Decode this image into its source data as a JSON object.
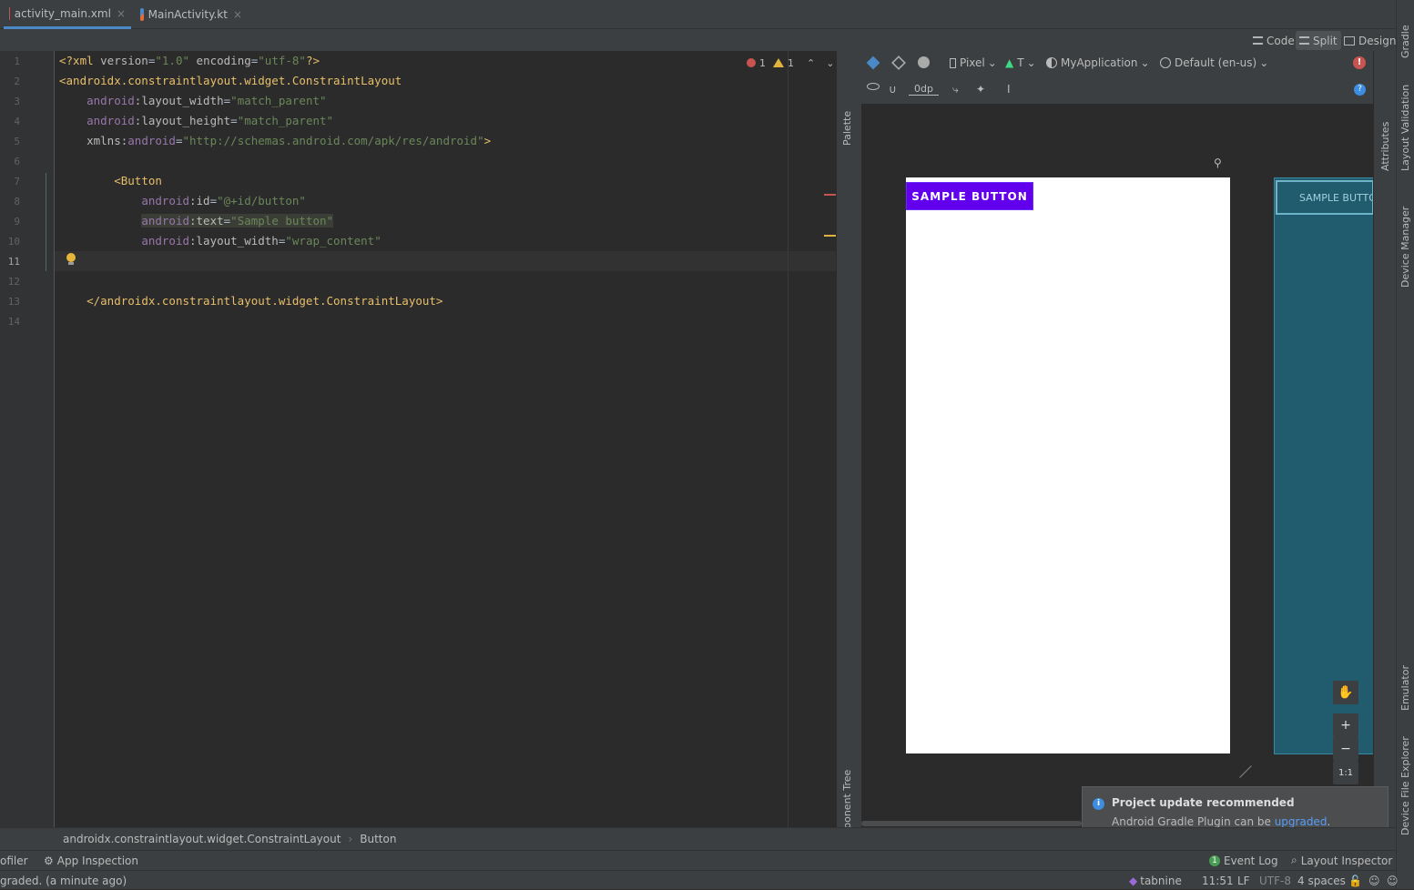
{
  "tabs": [
    {
      "label": "activity_main.xml",
      "close": "×"
    },
    {
      "label": "MainActivity.kt",
      "close": "×"
    }
  ],
  "view_modes": {
    "code": "Code",
    "split": "Split",
    "design": "Design",
    "selected": "Split"
  },
  "editor": {
    "line_numbers": [
      "1",
      "2",
      "3",
      "4",
      "5",
      "6",
      "7",
      "8",
      "9",
      "10",
      "11",
      "12",
      "13",
      "14"
    ],
    "current_line": "11",
    "inspections": {
      "errors": "1",
      "warnings": "1"
    },
    "lines": [
      [
        {
          "c": "tag",
          "t": "<?xml "
        },
        {
          "c": "attr",
          "t": "version"
        },
        {
          "c": "plain",
          "t": "="
        },
        {
          "c": "str",
          "t": "\"1.0\""
        },
        {
          "c": "attr",
          "t": " encoding"
        },
        {
          "c": "plain",
          "t": "="
        },
        {
          "c": "str",
          "t": "\"utf-8\""
        },
        {
          "c": "tag",
          "t": "?>"
        }
      ],
      [
        {
          "c": "tag",
          "t": "<androidx.constraintlayout.widget.ConstraintLayout"
        }
      ],
      [
        {
          "c": "plain",
          "t": "    "
        },
        {
          "c": "ns",
          "t": "android"
        },
        {
          "c": "attr",
          "t": ":layout_width"
        },
        {
          "c": "plain",
          "t": "="
        },
        {
          "c": "str",
          "t": "\"match_parent\""
        }
      ],
      [
        {
          "c": "plain",
          "t": "    "
        },
        {
          "c": "ns",
          "t": "android"
        },
        {
          "c": "attr",
          "t": ":layout_height"
        },
        {
          "c": "plain",
          "t": "="
        },
        {
          "c": "str",
          "t": "\"match_parent\""
        }
      ],
      [
        {
          "c": "plain",
          "t": "    "
        },
        {
          "c": "attr",
          "t": "xmlns:"
        },
        {
          "c": "ns",
          "t": "android"
        },
        {
          "c": "plain",
          "t": "="
        },
        {
          "c": "str",
          "t": "\"http://schemas.android.com/apk/res/android\""
        },
        {
          "c": "tag",
          "t": ">"
        }
      ],
      [],
      [
        {
          "c": "plain",
          "t": "        "
        },
        {
          "c": "tag",
          "t": "<Button"
        }
      ],
      [
        {
          "c": "plain",
          "t": "            "
        },
        {
          "c": "ns",
          "t": "android"
        },
        {
          "c": "attr",
          "t": ":id"
        },
        {
          "c": "plain",
          "t": "="
        },
        {
          "c": "str",
          "t": "\"@+id/button\""
        }
      ],
      [
        {
          "c": "plain",
          "t": "            "
        },
        {
          "c": "ns hl",
          "t": "android"
        },
        {
          "c": "attr hl",
          "t": ":text"
        },
        {
          "c": "plain hl",
          "t": "="
        },
        {
          "c": "str hl",
          "t": "\"Sample button\""
        }
      ],
      [
        {
          "c": "plain",
          "t": "            "
        },
        {
          "c": "ns",
          "t": "android"
        },
        {
          "c": "attr",
          "t": ":layout_width"
        },
        {
          "c": "plain",
          "t": "="
        },
        {
          "c": "str",
          "t": "\"wrap_content\""
        }
      ],
      [
        {
          "c": "plain",
          "t": "            "
        },
        {
          "c": "ns",
          "t": "android"
        },
        {
          "c": "attr",
          "t": ":layout_height"
        },
        {
          "c": "plain",
          "t": "="
        },
        {
          "c": "str",
          "t": "\"wrap_content\""
        },
        {
          "c": "tag",
          "t": "/>"
        }
      ],
      [],
      [
        {
          "c": "plain",
          "t": "    "
        },
        {
          "c": "tag",
          "t": "</androidx.constraintlayout.widget.ConstraintLayout>"
        }
      ],
      []
    ]
  },
  "side_panels": {
    "palette": "Palette",
    "component_tree": "Component Tree"
  },
  "design_toolbar": {
    "device": "Pixel",
    "api": "T",
    "theme": "MyApplication",
    "locale": "Default (en-us)",
    "margin": "0dp"
  },
  "preview": {
    "button_label": "SAMPLE BUTTON",
    "blueprint_button_label": "SAMPLE BUTTON"
  },
  "zoom": {
    "in": "+",
    "out": "−",
    "reset": "1:1"
  },
  "right_tools": [
    "Gradle",
    "Layout Validation",
    "Attributes",
    "Device Manager",
    "Emulator",
    "Device File Explorer"
  ],
  "notification": {
    "title": "Project update recommended",
    "body_prefix": "Android Gradle Plugin can be ",
    "link": "upgraded",
    "body_suffix": "."
  },
  "breadcrumb": [
    "androidx.constraintlayout.widget.ConstraintLayout",
    "Button"
  ],
  "tool_windows": {
    "profiler": "ofiler",
    "app_inspection": "App Inspection",
    "event_log": "Event Log",
    "event_count": "1",
    "layout_inspector": "Layout Inspector"
  },
  "status_bar": {
    "message": "graded. (a minute ago)",
    "tabnine": "tabnine",
    "time": "11:51",
    "line_sep": "LF",
    "encoding": "UTF-8",
    "indent": "4 spaces"
  },
  "colors": {
    "accent": "#4a88c7",
    "button": "#6200ee",
    "blueprint": "#215b6e"
  }
}
